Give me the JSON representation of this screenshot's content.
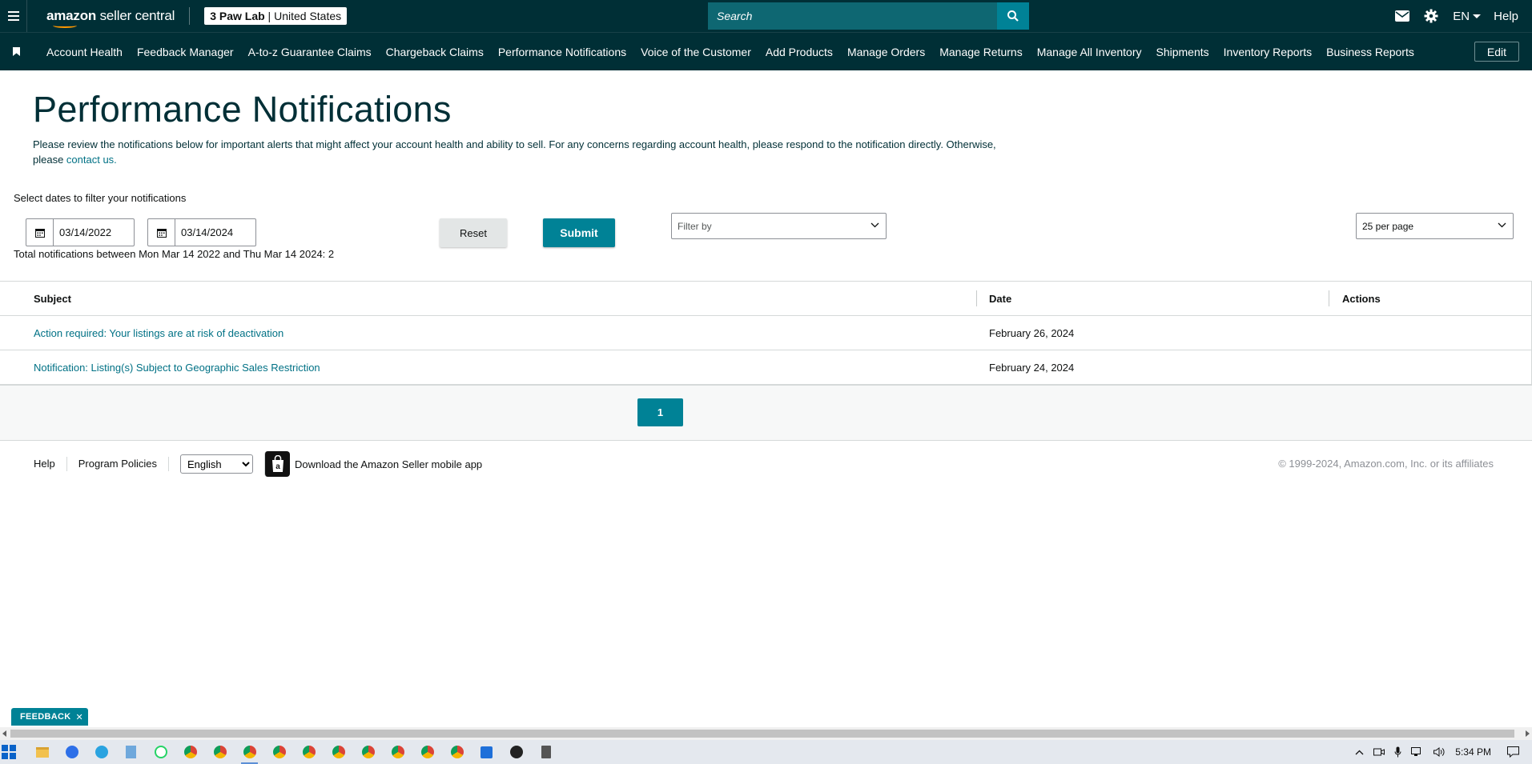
{
  "header": {
    "logo_text_bold": "amazon",
    "logo_text_rest": " seller central",
    "store_name": "3 Paw Lab",
    "store_country": "United States",
    "search_placeholder": "Search",
    "language": "EN",
    "help": "Help"
  },
  "nav": {
    "items": [
      "Account Health",
      "Feedback Manager",
      "A-to-z Guarantee Claims",
      "Chargeback Claims",
      "Performance Notifications",
      "Voice of the Customer",
      "Add Products",
      "Manage Orders",
      "Manage Returns",
      "Manage All Inventory",
      "Shipments",
      "Inventory Reports",
      "Business Reports"
    ],
    "edit": "Edit"
  },
  "page": {
    "title": "Performance Notifications",
    "intro_line1": "Please review the notifications below for important alerts that might affect your account health and ability to sell. For any concerns regarding account health, please respond to the notification directly. Otherwise,",
    "intro_prefix": "please ",
    "intro_link": "contact us.",
    "filter_label": "Select dates to filter your notifications",
    "date_from": "03/14/2022",
    "date_to": "03/14/2024",
    "total_text": "Total notifications between Mon Mar 14 2022 and Thu Mar 14 2024: 2",
    "reset": "Reset",
    "submit": "Submit",
    "filter_placeholder": "Filter by",
    "per_page": "25 per page"
  },
  "table": {
    "headers": {
      "subject": "Subject",
      "date": "Date",
      "actions": "Actions"
    },
    "rows": [
      {
        "subject": "Action required: Your listings are at risk of deactivation",
        "date": "February 26, 2024"
      },
      {
        "subject": "Notification: Listing(s) Subject to Geographic Sales Restriction",
        "date": "February 24, 2024"
      }
    ]
  },
  "pagination": {
    "current": "1"
  },
  "footer": {
    "help": "Help",
    "program_policies": "Program Policies",
    "language": "English",
    "app_text": "Download the Amazon Seller mobile app",
    "copyright": "© 1999-2024, Amazon.com, Inc. or its affiliates"
  },
  "feedback": {
    "label": "FEEDBACK"
  },
  "taskbar": {
    "time": "5:34 PM"
  },
  "colors": {
    "header_bg": "#002f36",
    "accent": "#008296",
    "link": "#007185"
  }
}
